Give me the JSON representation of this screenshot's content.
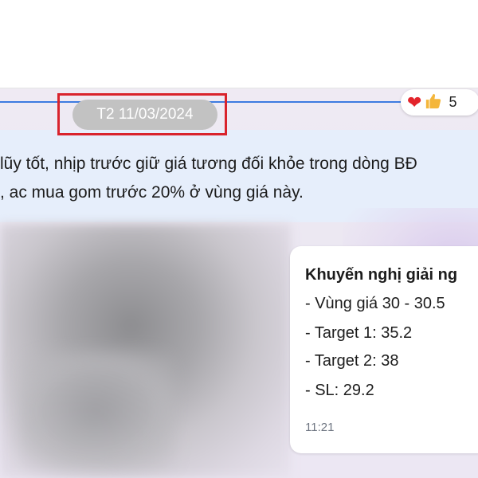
{
  "date_separator": "T2 11/03/2024",
  "reactions": {
    "heart_icon": "heart-icon",
    "thumb_icon": "thumbs-up-icon",
    "count": "5"
  },
  "message": {
    "line1": "lũy tốt, nhịp trước giữ giá tương đối khỏe trong dòng BĐ",
    "line2": ", ac mua gom trước 20% ở vùng giá này."
  },
  "recommendation": {
    "title": "Khuyến nghị giải ng",
    "items": [
      "- Vùng giá 30 - 30.5",
      "- Target 1: 35.2",
      "- Target 2: 38",
      "- SL: 29.2"
    ],
    "time": "11:21"
  },
  "colors": {
    "highlight": "#d9232c",
    "accent_line": "#3d7be0",
    "message_bg": "#e6eefb"
  }
}
